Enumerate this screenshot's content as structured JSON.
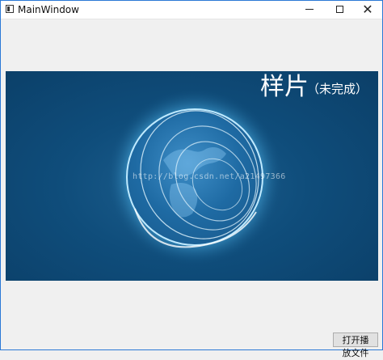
{
  "window": {
    "title": "MainWindow",
    "minimize_glyph": "",
    "maximize_glyph": "",
    "close_glyph": "✕"
  },
  "video": {
    "overlay_title": "样片",
    "overlay_subtitle": "（未完成）",
    "watermark": "http://blog.csdn.net/a21497366",
    "background_color": "#0f4d7b",
    "globe_glow_color": "#6ad0ff"
  },
  "actions": {
    "open_file_label": "打开播放文件"
  },
  "icons": {
    "app": "window-app-icon",
    "minimize": "minimize-icon",
    "maximize": "maximize-icon",
    "close": "close-icon"
  }
}
